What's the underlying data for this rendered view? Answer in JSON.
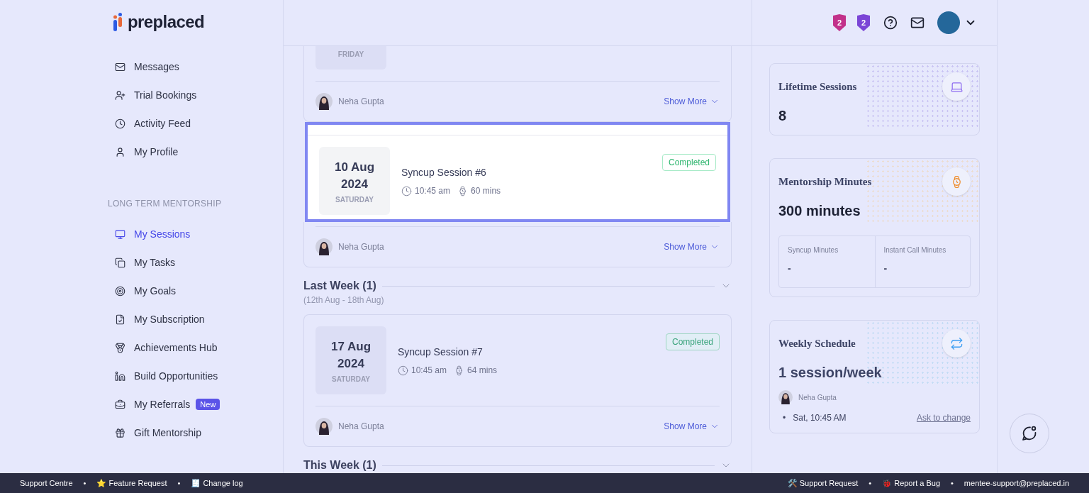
{
  "logo": {
    "text": "preplaced"
  },
  "sidebar": {
    "items": [
      {
        "label": "Messages",
        "selected": false
      },
      {
        "label": "Trial Bookings",
        "selected": false
      },
      {
        "label": "Activity Feed",
        "selected": false
      },
      {
        "label": "My Profile",
        "selected": false
      }
    ],
    "section_title": "LONG TERM MENTORSHIP",
    "section_items": [
      {
        "label": "My Sessions",
        "selected": true
      },
      {
        "label": "My Tasks",
        "selected": false
      },
      {
        "label": "My Goals",
        "selected": false
      },
      {
        "label": "My Subscription",
        "selected": false
      },
      {
        "label": "Achievements Hub",
        "selected": false
      },
      {
        "label": "Build Opportunities",
        "selected": false
      },
      {
        "label": "My Referrals",
        "selected": false,
        "badge": "New"
      },
      {
        "label": "Gift Mentorship",
        "selected": false
      }
    ]
  },
  "header": {
    "badges": [
      {
        "text": "2",
        "color": "#c2318a"
      },
      {
        "text": "2",
        "color": "#7b45d6"
      }
    ]
  },
  "groups": [
    {
      "sessions": [
        {
          "weekday": "FRIDAY",
          "mentor": "Neha Gupta",
          "action": "Show More",
          "highlighted": false
        },
        {
          "day": "10 Aug",
          "year": "2024",
          "weekday": "SATURDAY",
          "title": "Syncup Session #6",
          "time": "10:45 am",
          "duration": "60 mins",
          "status": "Completed",
          "mentor": "Neha Gupta",
          "action": "Show More",
          "highlighted": true
        }
      ]
    },
    {
      "title": "Last Week (1)",
      "range": "(12th Aug - 18th Aug)",
      "expanded": true,
      "sessions": [
        {
          "day": "17 Aug",
          "year": "2024",
          "weekday": "SATURDAY",
          "title": "Syncup Session #7",
          "time": "10:45 am",
          "duration": "64 mins",
          "status": "Completed",
          "mentor": "Neha Gupta",
          "action": "Show More",
          "highlighted": false
        }
      ]
    },
    {
      "title": "This Week (1)",
      "expanded": true
    }
  ],
  "stats": {
    "lifetime": {
      "title": "Lifetime Sessions",
      "value": "8"
    },
    "minutes": {
      "title": "Mentorship Minutes",
      "value": "300 minutes",
      "parts": [
        {
          "label": "Syncup Minutes",
          "value": "-"
        },
        {
          "label": "Instant Call Minutes",
          "value": "-"
        }
      ]
    },
    "schedule": {
      "title": "Weekly Schedule",
      "value": "1 session/week",
      "mentor": "Neha Gupta",
      "slots": [
        {
          "marker": "•",
          "text": "Sat, 10:45 AM"
        }
      ],
      "action": "Ask to change"
    }
  },
  "footer": {
    "left": [
      {
        "kind": "link",
        "text": "Support Centre"
      },
      {
        "kind": "separator",
        "text": "•"
      },
      {
        "kind": "link",
        "text": "⭐ Feature Request"
      },
      {
        "kind": "separator",
        "text": "•"
      },
      {
        "kind": "link",
        "text": "🧾 Change log"
      }
    ],
    "right": [
      {
        "kind": "link",
        "text": "🛠️ Support Request"
      },
      {
        "kind": "separator",
        "text": "•"
      },
      {
        "kind": "link",
        "text": "🐞 Report a Bug"
      },
      {
        "kind": "separator",
        "text": "•"
      },
      {
        "kind": "link",
        "text": "mentee-support@preplaced.in"
      }
    ]
  }
}
